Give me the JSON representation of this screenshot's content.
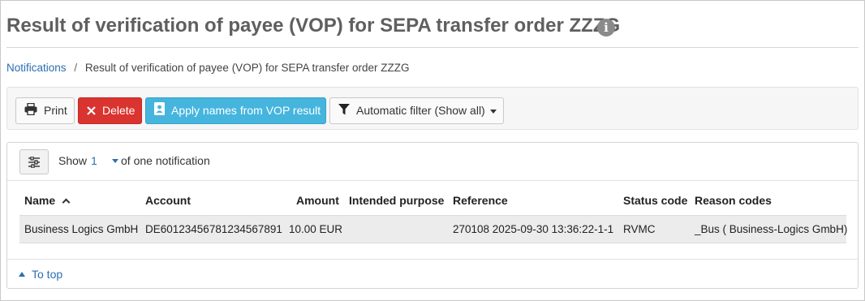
{
  "page": {
    "title": "Result of verification of payee (VOP) for SEPA transfer order ZZZG",
    "info_glyph": "i"
  },
  "breadcrumb": {
    "parent": "Notifications",
    "separator": "/",
    "current": "Result of verification of payee (VOP) for SEPA transfer order ZZZG"
  },
  "toolbar": {
    "print_label": "Print",
    "delete_label": "Delete",
    "apply_label": "Apply names from VOP result",
    "filter_label": "Automatic filter (Show all)"
  },
  "list_controls": {
    "show_label": "Show",
    "show_value": "1",
    "show_suffix": "of one notification"
  },
  "table": {
    "columns": [
      "Name",
      "Account",
      "Amount",
      "Intended purpose",
      "Reference",
      "Status code",
      "Reason codes"
    ],
    "sorted_column": "Name",
    "sort_direction": "ascending",
    "rows": [
      {
        "name": "Business Logics GmbH",
        "account": "DE60123456781234567891",
        "amount": "10.00 EUR",
        "intended_purpose": "",
        "reference": "270108 2025-09-30 13:36:22-1-1",
        "status_code": "RVMC",
        "reason_codes": "_Bus ( Business-Logics GmbH)"
      }
    ]
  },
  "footer": {
    "to_top_label": "To top"
  },
  "colors": {
    "link": "#2a6fb0",
    "delete_button": "#d9342f",
    "apply_button": "#45b5dd",
    "title_text": "#5f5f5f"
  },
  "icons": {
    "info": "info-circle-icon",
    "print": "printer-icon",
    "delete": "x-icon",
    "apply": "contact-card-icon",
    "filter": "funnel-icon",
    "settings": "sliders-icon",
    "sort": "chevron-up-icon",
    "to_top": "triangle-up-icon"
  }
}
